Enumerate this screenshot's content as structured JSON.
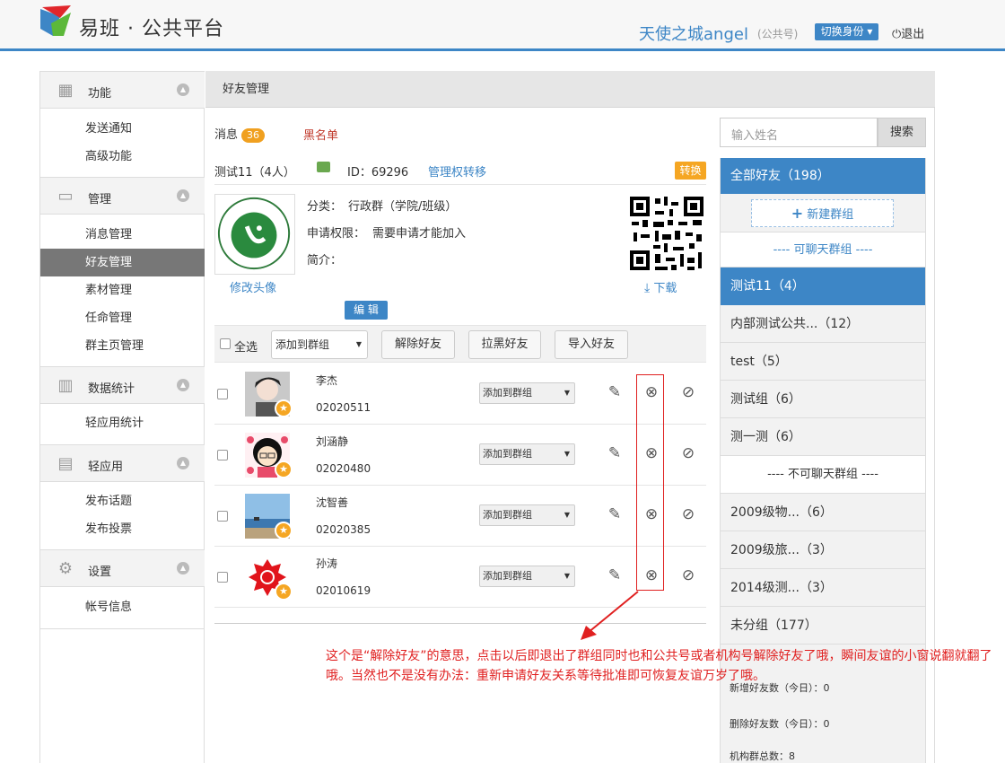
{
  "header": {
    "brand": "易班 · 公共平台",
    "user": "天使之城angel",
    "account_type": "(公共号)",
    "switch_label": "切换身份 ▾",
    "logout_label": "退出"
  },
  "sidebar": {
    "sections": [
      {
        "label": "功能",
        "icon": "grid-icon",
        "items": [
          "发送通知",
          "高级功能"
        ]
      },
      {
        "label": "管理",
        "icon": "inbox-icon",
        "items": [
          "消息管理",
          "好友管理",
          "素材管理",
          "任命管理",
          "群主页管理"
        ]
      },
      {
        "label": "数据统计",
        "icon": "bar-chart-icon",
        "items": [
          "轻应用统计"
        ]
      },
      {
        "label": "轻应用",
        "icon": "printer-icon",
        "items": [
          "发布话题",
          "发布投票"
        ]
      },
      {
        "label": "设置",
        "icon": "gear-icon",
        "items": [
          "帐号信息"
        ]
      }
    ],
    "active": "好友管理"
  },
  "main": {
    "title": "好友管理",
    "tab_messages": "消息",
    "messages_count": "36",
    "tab_blacklist": "黑名单",
    "group": {
      "name": "测试11（4人）",
      "id_label": "ID：69296",
      "transfer": "管理权转移",
      "convert": "转换",
      "category": "分类：",
      "category_value": "行政群（学院/班级）",
      "permission": "申请权限：",
      "permission_value": "需要申请才能加入",
      "intro": "简介：",
      "change_avatar": "修改头像",
      "download": "下载",
      "edit": "编 辑"
    },
    "toolbar": {
      "select_all": "全选",
      "add_to_group": "添加到群组",
      "remove_friend": "解除好友",
      "block_friend": "拉黑好友",
      "import_friend": "导入好友"
    },
    "friends": [
      {
        "name": "李杰",
        "id": "02020511",
        "group": "添加到群组"
      },
      {
        "name": "刘涵静",
        "id": "02020480",
        "group": "添加到群组"
      },
      {
        "name": "沈智善",
        "id": "02020385",
        "group": "添加到群组"
      },
      {
        "name": "孙涛",
        "id": "02010619",
        "group": "添加到群组"
      }
    ]
  },
  "right": {
    "search_placeholder": "输入姓名",
    "search_button": "搜索",
    "all_friends": "全部好友（198）",
    "new_group": "新建群组",
    "chat_groups_header": "----  可聊天群组  ----",
    "chat_groups": [
      {
        "label": "测试11（4）",
        "active": true
      },
      {
        "label": "内部测试公共...（12）"
      },
      {
        "label": "test（5）"
      },
      {
        "label": "测试组（6）"
      },
      {
        "label": "测一测（6）"
      }
    ],
    "nochat_header": "----  不可聊天群组  ----",
    "nochat_groups": [
      "2009级物...（6）",
      "2009级旅...（3）",
      "2014级测...（3）",
      "未分组（177）"
    ],
    "stats": [
      "新增好友数（今日）：0",
      "删除好友数（今日）：0",
      "机构群总数：8"
    ]
  },
  "annotation": "这个是“解除好友”的意思，点击以后即退出了群组同时也和公共号或者机构号解除好友了哦，瞬间友谊的小窗说翻就翻了哦。当然也不是没有办法：重新申请好友关系等待批准即可恢复友谊万岁了哦。"
}
